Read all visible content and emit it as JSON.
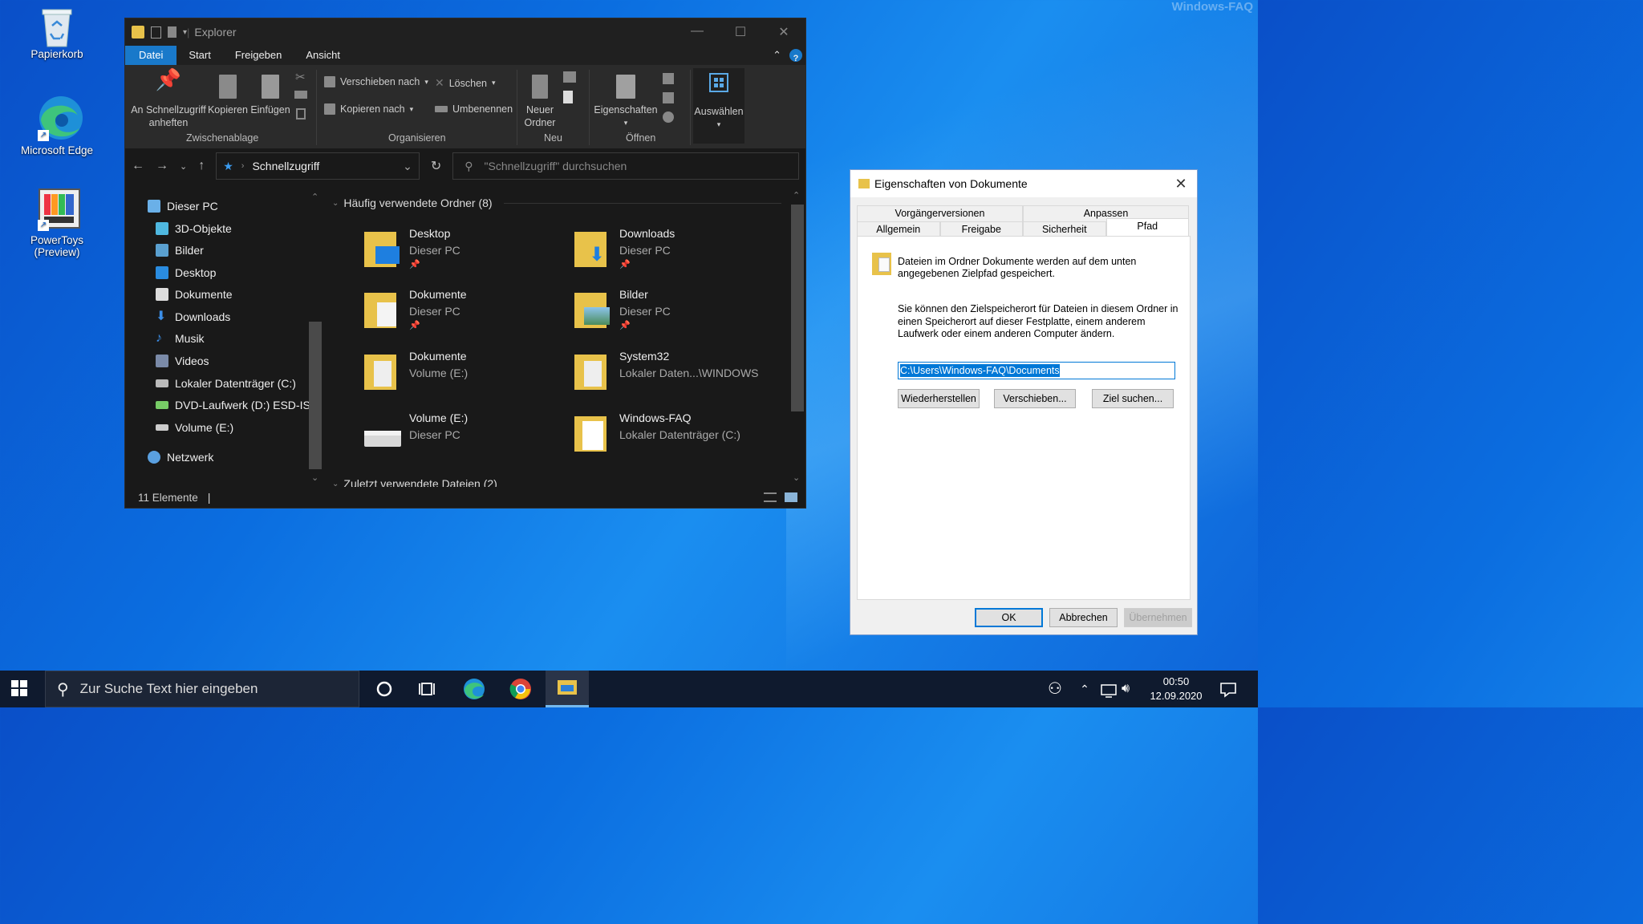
{
  "watermark": "Windows-FAQ",
  "desktop_icons": [
    {
      "label": "Papierkorb",
      "icon": "recycle-bin-icon"
    },
    {
      "label": "Microsoft Edge",
      "icon": "edge-icon"
    },
    {
      "label": "PowerToys (Preview)",
      "icon": "powertoys-icon"
    }
  ],
  "explorer": {
    "title": "Explorer",
    "menu": {
      "file": "Datei",
      "start": "Start",
      "share": "Freigeben",
      "view": "Ansicht",
      "help": "?"
    },
    "ribbon": {
      "pin": "An Schnellzugriff anheften",
      "pin_l1": "An Schnellzugriff",
      "pin_l2": "anheften",
      "copy": "Kopieren",
      "paste": "Einfügen",
      "move_to": "Verschieben nach",
      "copy_to": "Kopieren nach",
      "delete": "Löschen",
      "rename": "Umbenennen",
      "new_folder_l1": "Neuer",
      "new_folder_l2": "Ordner",
      "properties": "Eigenschaften",
      "select": "Auswählen",
      "groups": {
        "clipboard": "Zwischenablage",
        "organize": "Organisieren",
        "new": "Neu",
        "open": "Öffnen"
      }
    },
    "address": {
      "location": "Schnellzugriff",
      "search_placeholder": "\"Schnellzugriff\" durchsuchen"
    },
    "nav": [
      "Dieser PC",
      "3D-Objekte",
      "Bilder",
      "Desktop",
      "Dokumente",
      "Downloads",
      "Musik",
      "Videos",
      "Lokaler Datenträger (C:)",
      "DVD-Laufwerk (D:) ESD-ISO",
      "Volume (E:)",
      "Netzwerk"
    ],
    "section_frequent": "Häufig verwendete Ordner (8)",
    "section_recent": "Zuletzt verwendete Dateien (2)",
    "tiles": [
      {
        "name": "Desktop",
        "sub": "Dieser PC",
        "pinned": true
      },
      {
        "name": "Downloads",
        "sub": "Dieser PC",
        "pinned": true
      },
      {
        "name": "Dokumente",
        "sub": "Dieser PC",
        "pinned": true
      },
      {
        "name": "Bilder",
        "sub": "Dieser PC",
        "pinned": true
      },
      {
        "name": "Dokumente",
        "sub": "Volume (E:)",
        "pinned": false
      },
      {
        "name": "System32",
        "sub": "Lokaler Daten...\\WINDOWS",
        "pinned": false
      },
      {
        "name": "Volume (E:)",
        "sub": "Dieser PC",
        "pinned": false
      },
      {
        "name": "Windows-FAQ",
        "sub": "Lokaler Datenträger (C:)",
        "pinned": false
      }
    ],
    "status": "11 Elemente"
  },
  "dialog": {
    "title": "Eigenschaften von Dokumente",
    "tabs_top": [
      "Vorgängerversionen",
      "Anpassen"
    ],
    "tabs_bottom": [
      "Allgemein",
      "Freigabe",
      "Sicherheit",
      "Pfad"
    ],
    "info1": "Dateien im Ordner Dokumente werden auf dem unten angegebenen Zielpfad gespeichert.",
    "info2": "Sie können den Zielspeicherort für Dateien in diesem Ordner in einen Speicherort auf dieser Festplatte, einem anderem Laufwerk oder einem anderen Computer ändern.",
    "path_value": "C:\\Users\\Windows-FAQ\\Documents",
    "btn_restore": "Wiederherstellen",
    "btn_move": "Verschieben...",
    "btn_find": "Ziel suchen...",
    "btn_ok": "OK",
    "btn_cancel": "Abbrechen",
    "btn_apply": "Übernehmen"
  },
  "taskbar": {
    "search_placeholder": "Zur Suche Text hier eingeben",
    "time": "00:50",
    "date": "12.09.2020"
  }
}
